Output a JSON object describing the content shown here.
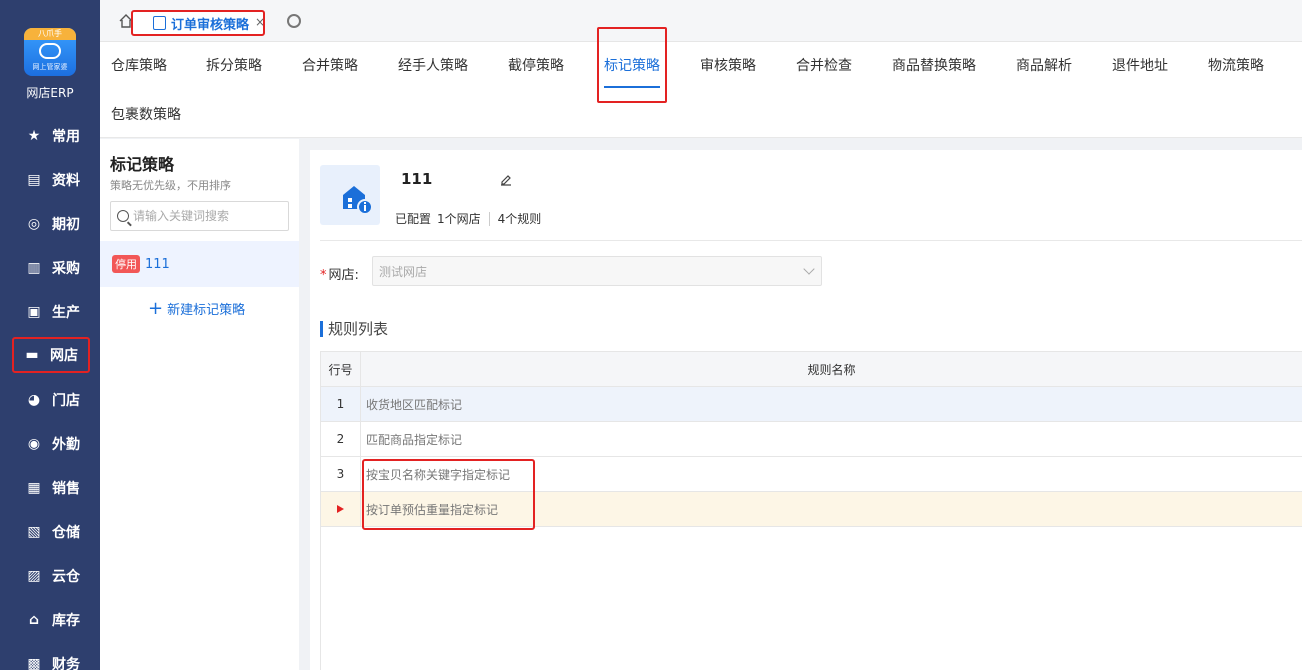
{
  "sidebar": {
    "logo_tag": "八爪手",
    "logo_sub": "网上管家婆",
    "app_name": "网店ERP",
    "items": [
      {
        "label": "常用",
        "icon": "star-icon"
      },
      {
        "label": "资料",
        "icon": "profile-icon"
      },
      {
        "label": "期初",
        "icon": "target-icon"
      },
      {
        "label": "采购",
        "icon": "purchase-icon"
      },
      {
        "label": "生产",
        "icon": "production-icon"
      },
      {
        "label": "网店",
        "icon": "shop-icon"
      },
      {
        "label": "门店",
        "icon": "pie-icon"
      },
      {
        "label": "外勤",
        "icon": "field-icon"
      },
      {
        "label": "销售",
        "icon": "chart-icon"
      },
      {
        "label": "仓储",
        "icon": "warehouse-icon"
      },
      {
        "label": "云仓",
        "icon": "cloud-warehouse-icon"
      },
      {
        "label": "库存",
        "icon": "inventory-icon"
      },
      {
        "label": "财务",
        "icon": "finance-icon"
      }
    ]
  },
  "topbar": {
    "active_tab": "订单审核策略",
    "close_glyph": "×"
  },
  "strategy_tabs": [
    "仓库策略",
    "拆分策略",
    "合并策略",
    "经手人策略",
    "截停策略",
    "标记策略",
    "审核策略",
    "合并检查",
    "商品替换策略",
    "商品解析",
    "退件地址",
    "物流策略",
    "包裹数策略"
  ],
  "left_panel": {
    "title": "标记策略",
    "subtitle": "策略无优先级，不用排序",
    "search_placeholder": "请输入关键词搜索",
    "item_badge": "停用",
    "item_name": "111",
    "new_button": "新建标记策略",
    "plus": "+"
  },
  "main": {
    "title": "111",
    "status": "已配置",
    "shops": "1个网店",
    "rules": "4个规则",
    "shop_label": "网店:",
    "required_mark": "*",
    "shop_value": "测试网店",
    "rules_heading": "规则列表",
    "table": {
      "col_index": "行号",
      "col_name": "规则名称",
      "rows": [
        {
          "index": "1",
          "name": "收货地区匹配标记"
        },
        {
          "index": "2",
          "name": "匹配商品指定标记"
        },
        {
          "index": "3",
          "name": "按宝贝名称关键字指定标记"
        },
        {
          "index": "",
          "name": "按订单预估重量指定标记"
        }
      ]
    }
  },
  "colors": {
    "sidebar_bg": "#2e3f6e",
    "accent": "#1b6fd9",
    "highlight": "#e32222",
    "badge": "#f25757"
  }
}
